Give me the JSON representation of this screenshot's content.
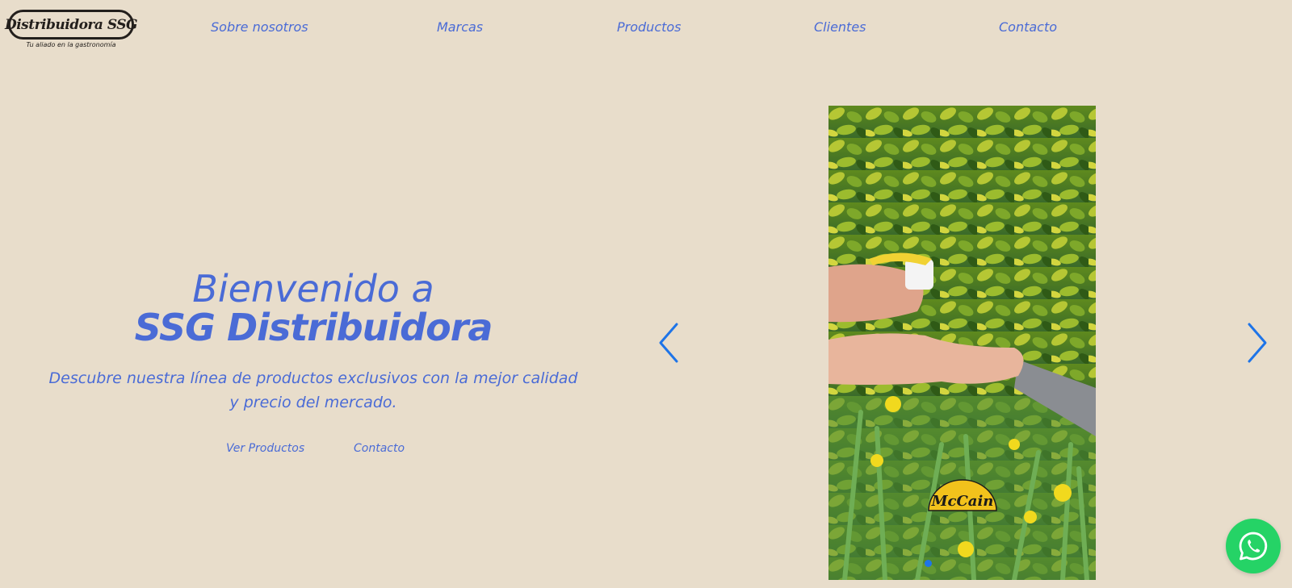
{
  "brand": {
    "name": "Distribuidora SSG",
    "tagline": "Tu aliado en la gastronomía"
  },
  "nav": {
    "items": [
      {
        "label": "Sobre nosotros"
      },
      {
        "label": "Marcas"
      },
      {
        "label": "Productos"
      },
      {
        "label": "Clientes"
      },
      {
        "label": "Contacto"
      }
    ]
  },
  "hero": {
    "title_line1": "Bienvenido a",
    "title_line2": "SSG Distribuidora",
    "subtitle": "Descubre nuestra línea de productos exclusivos con la mejor calidad y precio del mercado.",
    "primary_cta": "Ver Productos",
    "secondary_cta": "Contacto"
  },
  "carousel": {
    "prev_icon": "chevron-left-icon",
    "next_icon": "chevron-right-icon",
    "slide_logo_text": "McCain",
    "active_slide": 1,
    "accent_color": "#1e74e8"
  },
  "whatsapp": {
    "icon": "whatsapp-icon",
    "color": "#25d366"
  },
  "colors": {
    "background": "#e8ddcb",
    "text_accent": "#4a6bd6"
  }
}
